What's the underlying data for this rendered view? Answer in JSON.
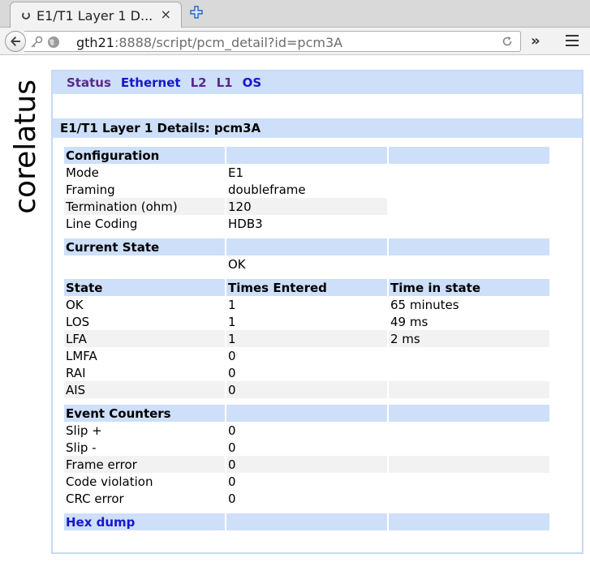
{
  "browser": {
    "tab_title": "E1/T1 Layer 1 D...",
    "tab_close": "×",
    "url_host": "gth21",
    "url_rest": ":8888/script/pcm_detail?id=pcm3A",
    "overflow_label": "»"
  },
  "brand": "corelatus",
  "nav": {
    "items": [
      {
        "label": "Status",
        "visited": true
      },
      {
        "label": "Ethernet",
        "visited": false
      },
      {
        "label": "L2",
        "visited": true
      },
      {
        "label": "L1",
        "visited": true
      },
      {
        "label": "OS",
        "visited": false
      }
    ]
  },
  "page_heading": "E1/T1 Layer 1 Details: pcm3A",
  "configuration": {
    "header": "Configuration",
    "rows": [
      {
        "label": "Mode",
        "value": "E1"
      },
      {
        "label": "Framing",
        "value": "doubleframe"
      },
      {
        "label": "Termination (ohm)",
        "value": "120"
      },
      {
        "label": "Line Coding",
        "value": "HDB3"
      }
    ]
  },
  "current_state": {
    "header": "Current State",
    "value": "OK"
  },
  "states": {
    "headers": [
      "State",
      "Times Entered",
      "Time in state"
    ],
    "rows": [
      {
        "state": "OK",
        "times": "1",
        "time": "65 minutes"
      },
      {
        "state": "LOS",
        "times": "1",
        "time": "49 ms"
      },
      {
        "state": "LFA",
        "times": "1",
        "time": "2 ms"
      },
      {
        "state": "LMFA",
        "times": "0",
        "time": ""
      },
      {
        "state": "RAI",
        "times": "0",
        "time": ""
      },
      {
        "state": "AIS",
        "times": "0",
        "time": ""
      }
    ]
  },
  "event_counters": {
    "header": "Event Counters",
    "rows": [
      {
        "label": "Slip +",
        "value": "0"
      },
      {
        "label": "Slip -",
        "value": "0"
      },
      {
        "label": "Frame error",
        "value": "0"
      },
      {
        "label": "Code violation",
        "value": "0"
      },
      {
        "label": "CRC error",
        "value": "0"
      }
    ]
  },
  "hex_dump_label": "Hex dump",
  "colors": {
    "header_bg": "#cddff9",
    "link": "#1717c8",
    "visited_link": "#5a2a8a",
    "alt_row": "#f2f2f2"
  }
}
